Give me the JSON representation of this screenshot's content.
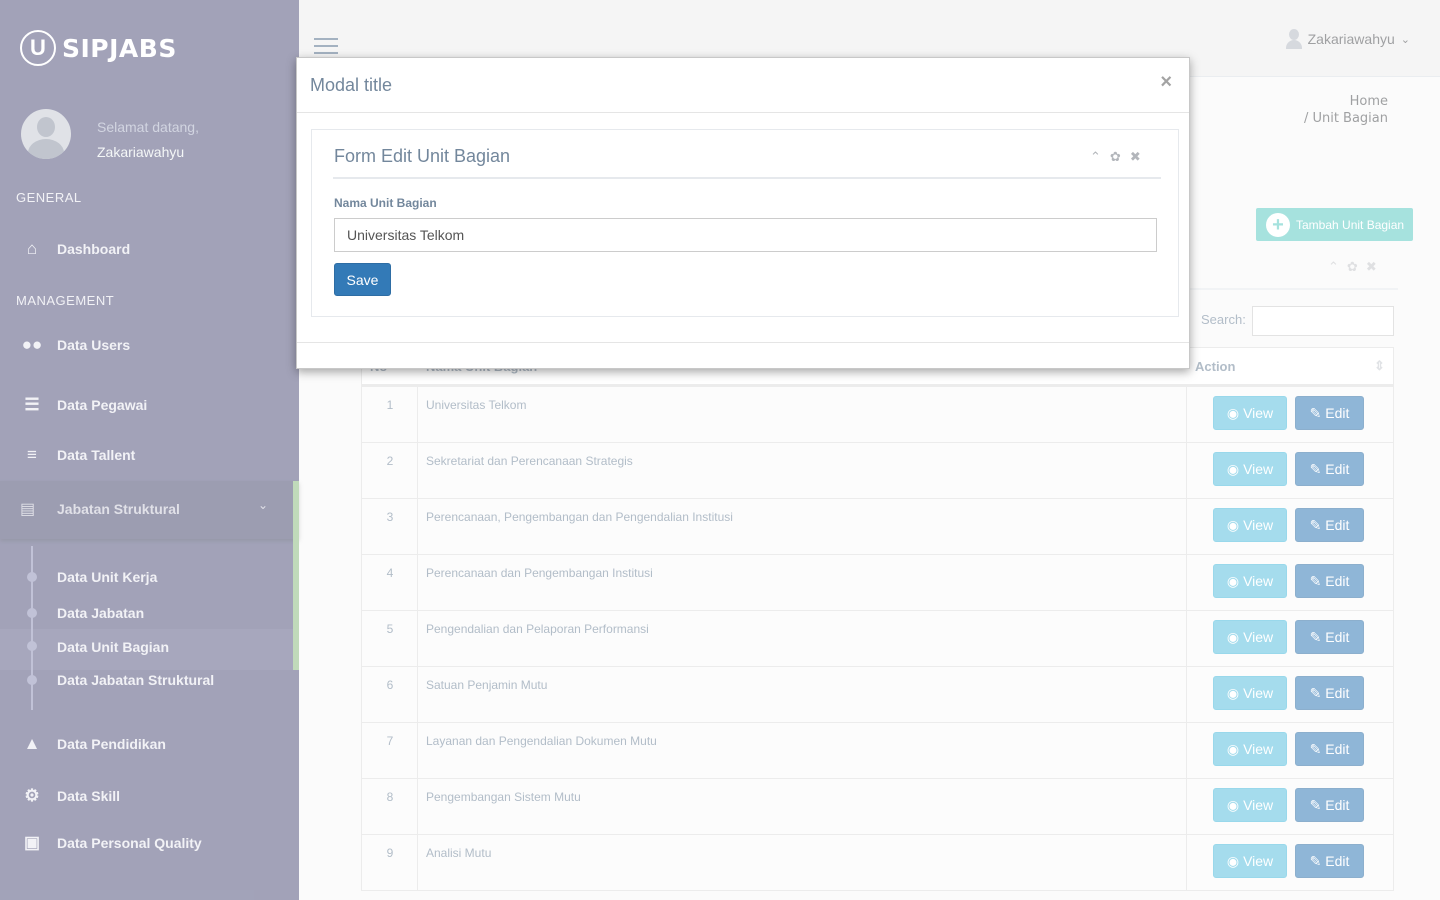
{
  "app": {
    "brand": "SIPJABS",
    "logo_letter": "U"
  },
  "profile": {
    "welcome": "Selamat datang,",
    "name": "Zakariawahyu"
  },
  "sidebar": {
    "general_title": "GENERAL",
    "management_title": "MANAGEMENT",
    "items": {
      "dashboard": {
        "label": "Dashboard",
        "icon": "home-icon"
      },
      "users": {
        "label": "Data Users",
        "icon": "users-icon"
      },
      "pegawai": {
        "label": "Data Pegawai",
        "icon": "database-icon"
      },
      "tallent": {
        "label": "Data Tallent",
        "icon": "list-icon"
      },
      "jabatan_struktural": {
        "label": "Jabatan Struktural",
        "icon": "newspaper-icon"
      },
      "pendidikan": {
        "label": "Data Pendidikan",
        "icon": "graduation-cap-icon"
      },
      "skill": {
        "label": "Data Skill",
        "icon": "gear-icon"
      },
      "personal_quality": {
        "label": "Data Personal Quality",
        "icon": "briefcase-icon"
      }
    },
    "submenu": [
      {
        "label": "Data Unit Kerja"
      },
      {
        "label": "Data Jabatan"
      },
      {
        "label": "Data Unit Bagian"
      },
      {
        "label": "Data Jabatan Struktural"
      }
    ]
  },
  "topbar": {
    "user": "Zakariawahyu"
  },
  "breadcrumb": {
    "home": "Home",
    "current": "/ Unit Bagian"
  },
  "page": {
    "add_button": "Tambah Unit Bagian",
    "search_label": "Search:"
  },
  "table": {
    "columns": {
      "no": "No",
      "name": "Nama Unit Bagian",
      "action": "Action"
    },
    "view_label": "View",
    "edit_label": "Edit",
    "rows": [
      {
        "no": "1",
        "name": "Universitas Telkom"
      },
      {
        "no": "2",
        "name": "Sekretariat dan Perencanaan Strategis"
      },
      {
        "no": "3",
        "name": "Perencanaan, Pengembangan dan Pengendalian Institusi"
      },
      {
        "no": "4",
        "name": "Perencanaan dan Pengembangan Institusi"
      },
      {
        "no": "5",
        "name": "Pengendalian dan Pelaporan Performansi"
      },
      {
        "no": "6",
        "name": "Satuan Penjamin Mutu"
      },
      {
        "no": "7",
        "name": "Layanan dan Pengendalian Dokumen Mutu"
      },
      {
        "no": "8",
        "name": "Pengembangan Sistem Mutu"
      },
      {
        "no": "9",
        "name": "Analisi Mutu"
      }
    ]
  },
  "modal": {
    "title": "Modal title",
    "panel_title": "Form Edit Unit Bagian",
    "field_label": "Nama Unit Bagian",
    "field_value": "Universitas Telkom",
    "save_label": "Save"
  },
  "colors": {
    "sidebar": "#56577f",
    "accent_green": "#8cbc81",
    "primary": "#337ab7",
    "info": "#5bc0de",
    "success": "#5dcbc4"
  }
}
